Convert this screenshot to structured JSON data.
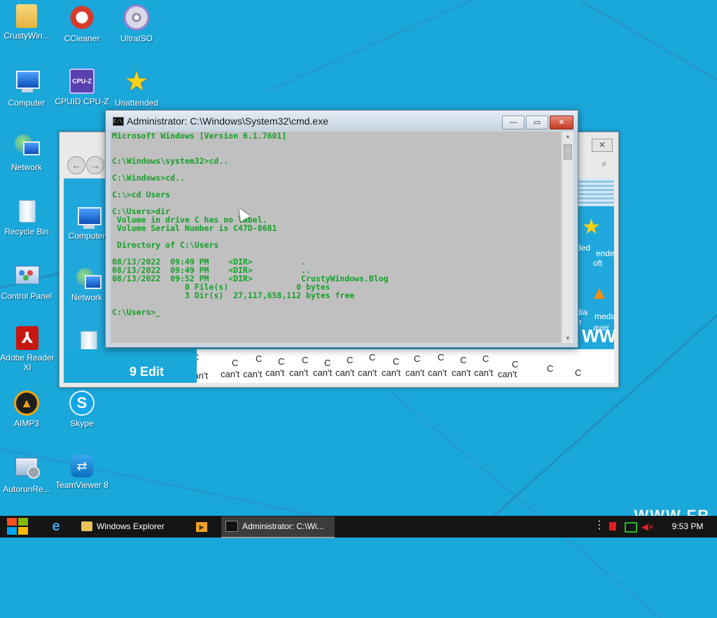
{
  "desktop": {
    "icons": [
      {
        "label": "CrustyWin...",
        "icon": "folder-icon"
      },
      {
        "label": "CCleaner",
        "icon": "ccleaner-icon"
      },
      {
        "label": "UltraISO",
        "icon": "disc-icon"
      },
      {
        "label": "Computer",
        "icon": "computer-icon"
      },
      {
        "label": "CPUID CPU-Z",
        "icon": "cpuz-icon"
      },
      {
        "label": "Unattended",
        "icon": "star-icon"
      },
      {
        "label": "Network",
        "icon": "network-icon"
      },
      {
        "label": "Recycle Bin",
        "icon": "recycle-bin-icon"
      },
      {
        "label": "Control Panel",
        "icon": "control-panel-icon"
      },
      {
        "label": "Adobe Reader XI",
        "icon": "pdf-icon"
      },
      {
        "label": "AIMP3",
        "icon": "aimp-icon"
      },
      {
        "label": "Skype",
        "icon": "skype-icon"
      },
      {
        "label": "AutorunRe...",
        "icon": "autorun-icon"
      },
      {
        "label": "TeamViewer 8",
        "icon": "teamviewer-icon"
      }
    ],
    "watermark": "WWW.FR"
  },
  "explorer": {
    "close_glyph": "✕",
    "back_glyph": "←",
    "forward_glyph": "→",
    "search_glyph": "⌕",
    "icons": [
      {
        "label": "Computer"
      },
      {
        "label": "Network"
      },
      {
        "label": "ded"
      },
      {
        "label": "ende"
      },
      {
        "label": "oft"
      },
      {
        "label": "dia"
      },
      {
        "label": "media"
      },
      {
        "label": "r"
      },
      {
        "label": "ayer"
      }
    ],
    "glitch_text": "Can't",
    "glitch_text_fragment": "can't",
    "glitch_letter": "C",
    "glitch_blue_text": "9 Edit",
    "glitch_ww": "WW"
  },
  "cmd": {
    "title": "Administrator: C:\\Windows\\System32\\cmd.exe",
    "icon_text": "C:\\",
    "min_glyph": "—",
    "max_glyph": "▭",
    "close_glyph": "✕",
    "scroll_up": "▲",
    "scroll_down": "▼",
    "lines": [
      "Microsoft Windows [Version 6.1.7601]",
      "",
      "",
      "C:\\Windows\\system32>cd..",
      "",
      "C:\\Windows>cd..",
      "",
      "C:\\>cd Users",
      "",
      "C:\\Users>dir",
      " Volume in drive C has no label.",
      " Volume Serial Number is C47D-8681",
      "",
      " Directory of C:\\Users",
      "",
      "08/13/2022  09:49 PM    <DIR>          .",
      "08/13/2022  09:49 PM    <DIR>          ..",
      "08/13/2022  09:52 PM    <DIR>          CrustyWindows.Blog",
      "               0 File(s)              0 bytes",
      "               3 Dir(s)  27,117,658,112 bytes free",
      "",
      "C:\\Users>_"
    ]
  },
  "taskbar": {
    "ie_glyph": "e",
    "media_glyph": "▶",
    "items": [
      {
        "label": "Windows Explorer",
        "icon": "folder-icon"
      },
      {
        "label": "Administrator: C:\\Wi...",
        "icon": "cmd-icon"
      }
    ],
    "tray_dots": "⋮",
    "volume_glyph": "◀×",
    "clock": "9:53 PM"
  },
  "colors": {
    "desktop_bg": "#1aa7da",
    "console_text": "#16a02a",
    "console_bg": "#c0c0c0",
    "taskbar_bg": "#151515"
  }
}
